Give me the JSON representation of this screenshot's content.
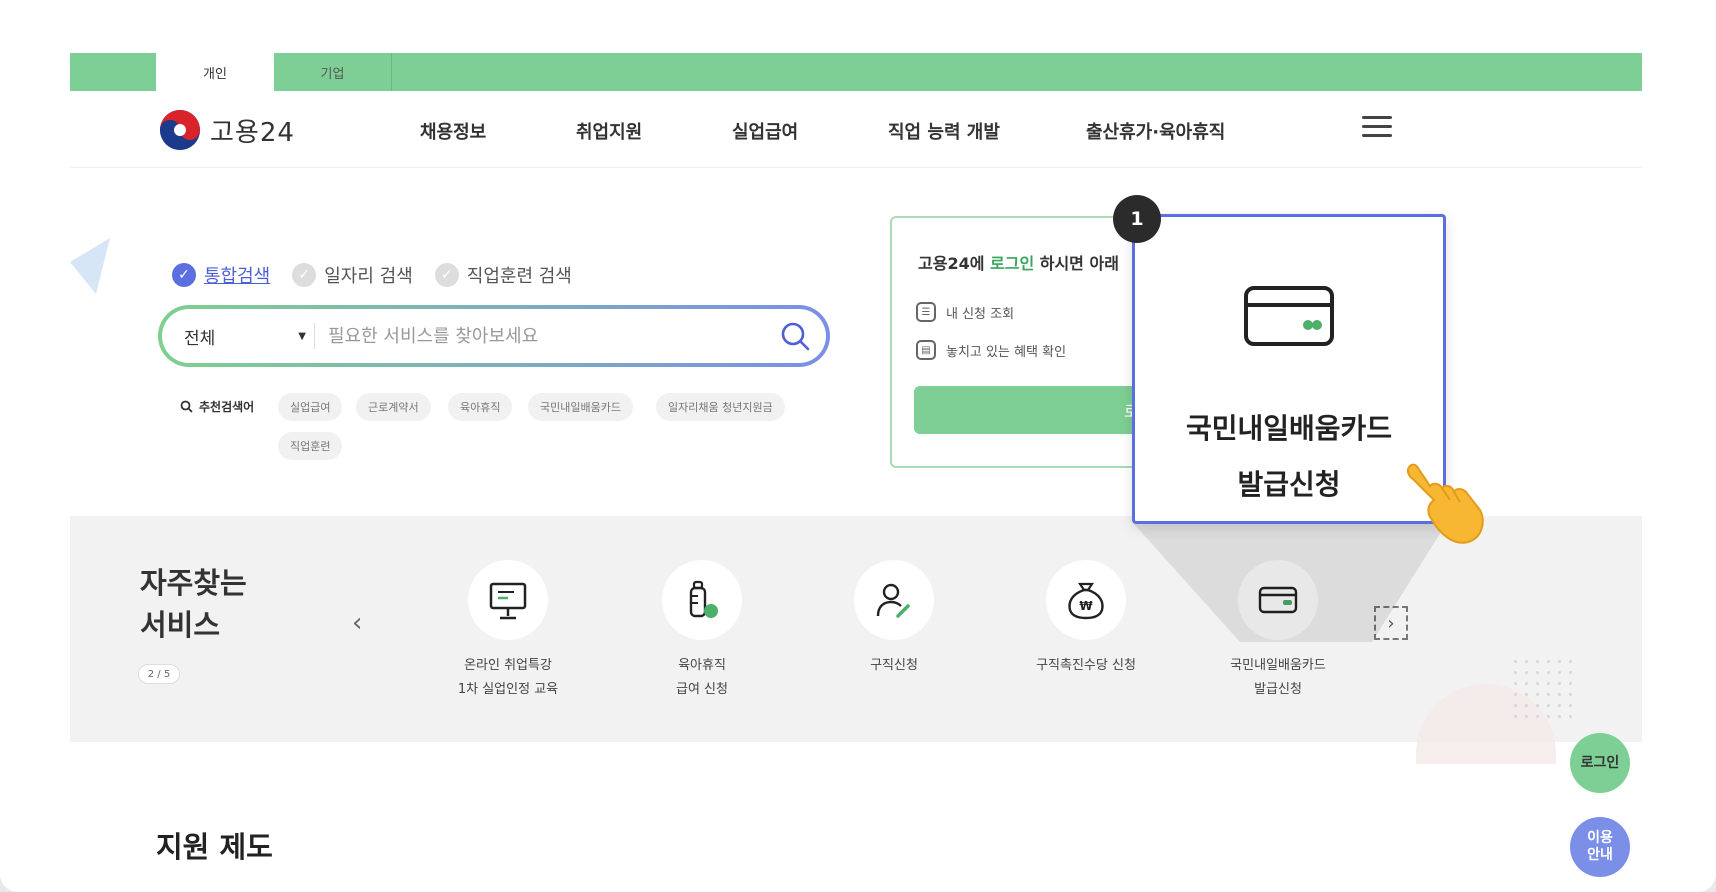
{
  "tabs": [
    {
      "label": "개인",
      "active": true
    },
    {
      "label": "기업",
      "active": false
    }
  ],
  "header": {
    "logo_text": "고용24",
    "nav": [
      "채용정보",
      "취업지원",
      "실업급여",
      "직업 능력 개발",
      "출산휴가·육아휴직"
    ]
  },
  "search": {
    "radios": [
      {
        "label": "통합검색",
        "checked": true
      },
      {
        "label": "일자리 검색",
        "checked": false
      },
      {
        "label": "직업훈련 검색",
        "checked": false
      }
    ],
    "category": "전체",
    "placeholder": "필요한 서비스를 찾아보세요",
    "recommended_label": "추천검색어",
    "chips": [
      "실업급여",
      "근로계약서",
      "육아휴직",
      "국민내일배움카드",
      "일자리채움 청년지원금",
      "직업훈련"
    ]
  },
  "login_panel": {
    "title_prefix": "고용24에 ",
    "title_highlight": "로그인",
    "title_suffix": " 하시면 아래",
    "rows": [
      "내 신청 조회",
      "놓치고 있는 혜택 확인"
    ],
    "button": "로"
  },
  "callout": {
    "badge": "1",
    "line1": "국민내일배움카드",
    "line2": "발급신청"
  },
  "services": {
    "title_line1": "자주찾는",
    "title_line2": "서비스",
    "pager": "2 / 5",
    "items": [
      {
        "icon": "presentation-icon",
        "line1": "온라인 취업특강",
        "line2": "1차 실업인정 교육"
      },
      {
        "icon": "baby-bottle-icon",
        "line1": "육아휴직",
        "line2": "급여 신청"
      },
      {
        "icon": "job-seeker-icon",
        "line1": "구직신청",
        "line2": ""
      },
      {
        "icon": "money-bag-icon",
        "line1": "구직촉진수당 신청",
        "line2": ""
      },
      {
        "icon": "card-icon",
        "line1": "국민내일배움카드",
        "line2": "발급신청"
      }
    ]
  },
  "section_title": "지원 제도",
  "fab": {
    "login": "로그인",
    "guide_line1": "이용",
    "guide_line2": "안내"
  },
  "colors": {
    "brand_green": "#7ecf95",
    "accent_blue": "#5b6fe0"
  }
}
